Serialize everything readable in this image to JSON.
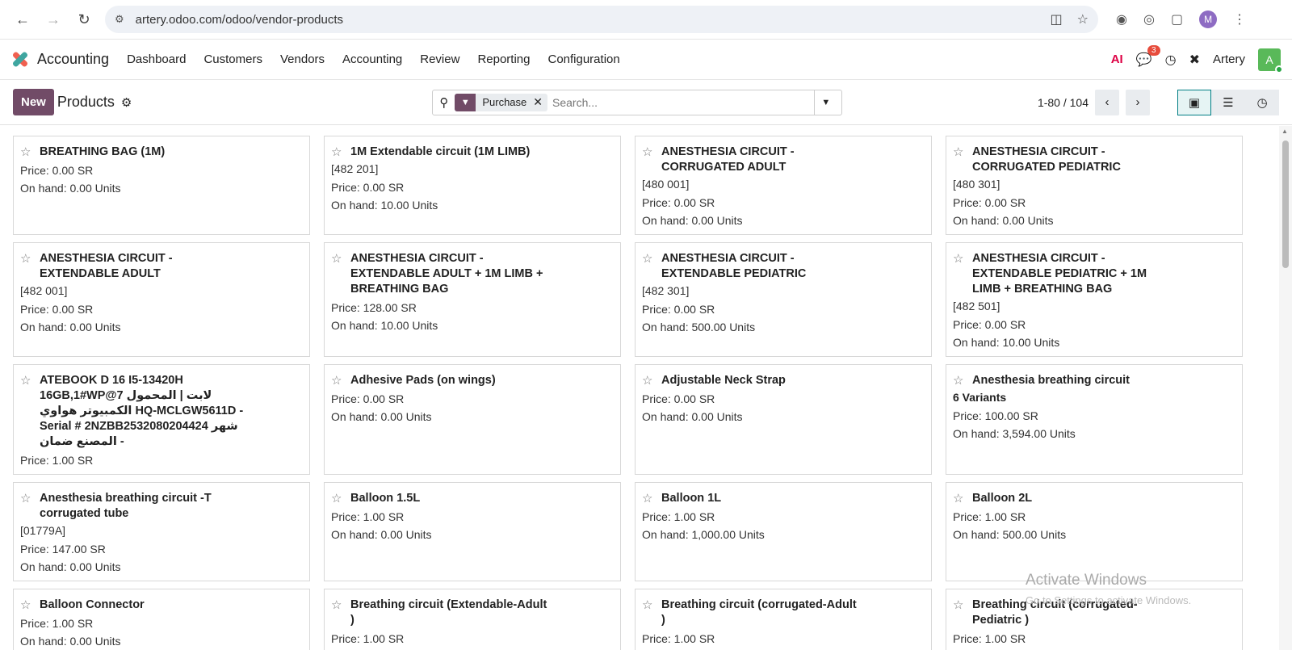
{
  "browser": {
    "url": "artery.odoo.com/odoo/vendor-products",
    "profile_initial": "M"
  },
  "navbar": {
    "app_name": "Accounting",
    "menu": [
      "Dashboard",
      "Customers",
      "Vendors",
      "Accounting",
      "Review",
      "Reporting",
      "Configuration"
    ],
    "chat_count": "3",
    "company": "Artery",
    "user_initial": "A"
  },
  "control": {
    "new_label": "New",
    "title": "Products",
    "facet": "Purchase",
    "search_placeholder": "Search...",
    "pager": "1-80 / 104"
  },
  "cards": [
    {
      "title": "BREATHING BAG (1M)",
      "ref": "",
      "variants": "",
      "price": "Price: 0.00 SR",
      "onhand": "On hand: 0.00 Units"
    },
    {
      "title": "1M Extendable circuit (1M LIMB)",
      "ref": "[482 201]",
      "variants": "",
      "price": "Price: 0.00 SR",
      "onhand": "On hand: 10.00 Units"
    },
    {
      "title": "ANESTHESIA CIRCUIT -\nCORRUGATED ADULT",
      "ref": "[480 001]",
      "variants": "",
      "price": "Price: 0.00 SR",
      "onhand": "On hand: 0.00 Units"
    },
    {
      "title": "ANESTHESIA CIRCUIT -\nCORRUGATED PEDIATRIC",
      "ref": "[480 301]",
      "variants": "",
      "price": "Price: 0.00 SR",
      "onhand": "On hand: 0.00 Units"
    },
    {
      "title": "ANESTHESIA CIRCUIT -\nEXTENDABLE ADULT",
      "ref": "[482 001]",
      "variants": "",
      "price": "Price: 0.00 SR",
      "onhand": "On hand: 0.00 Units"
    },
    {
      "title": "ANESTHESIA CIRCUIT -\nEXTENDABLE ADULT + 1M LIMB +\nBREATHING BAG",
      "ref": "",
      "variants": "",
      "price": "Price: 128.00 SR",
      "onhand": "On hand: 10.00 Units"
    },
    {
      "title": "ANESTHESIA CIRCUIT -\nEXTENDABLE PEDIATRIC",
      "ref": "[482 301]",
      "variants": "",
      "price": "Price: 0.00 SR",
      "onhand": "On hand: 500.00 Units"
    },
    {
      "title": "ANESTHESIA CIRCUIT -\nEXTENDABLE PEDIATRIC + 1M\nLIMB + BREATHING BAG",
      "ref": "[482 501]",
      "variants": "",
      "price": "Price: 0.00 SR",
      "onhand": "On hand: 10.00 Units"
    },
    {
      "title": "ATEBOOK D 16 I5-13420H\n16GB,1#WP@7 لابت | المحمول\nالكمبيوتر هواوي HQ-MCLGW5611D -\nSerial # 2NZBB2532080204424 شهر\nالمصنع ضمان -",
      "ref": "",
      "variants": "",
      "price": "Price: 1.00 SR",
      "onhand": ""
    },
    {
      "title": "Adhesive Pads (on wings)",
      "ref": "",
      "variants": "",
      "price": "Price: 0.00 SR",
      "onhand": "On hand: 0.00 Units"
    },
    {
      "title": "Adjustable Neck Strap",
      "ref": "",
      "variants": "",
      "price": "Price: 0.00 SR",
      "onhand": "On hand: 0.00 Units"
    },
    {
      "title": "Anesthesia breathing circuit",
      "ref": "",
      "variants": "6 Variants",
      "price": "Price: 100.00 SR",
      "onhand": "On hand: 3,594.00 Units"
    },
    {
      "title": "Anesthesia breathing circuit -T\ncorrugated tube",
      "ref": "[01779A]",
      "variants": "",
      "price": "Price: 147.00 SR",
      "onhand": "On hand: 0.00 Units"
    },
    {
      "title": "Balloon 1.5L",
      "ref": "",
      "variants": "",
      "price": "Price: 1.00 SR",
      "onhand": "On hand: 0.00 Units"
    },
    {
      "title": "Balloon 1L",
      "ref": "",
      "variants": "",
      "price": "Price: 1.00 SR",
      "onhand": "On hand: 1,000.00 Units"
    },
    {
      "title": "Balloon 2L",
      "ref": "",
      "variants": "",
      "price": "Price: 1.00 SR",
      "onhand": "On hand: 500.00 Units"
    },
    {
      "title": "Balloon Connector",
      "ref": "",
      "variants": "",
      "price": "Price: 1.00 SR",
      "onhand": "On hand: 0.00 Units"
    },
    {
      "title": "Breathing circuit (Extendable-Adult\n)",
      "ref": "",
      "variants": "",
      "price": "Price: 1.00 SR",
      "onhand": ""
    },
    {
      "title": "Breathing circuit (corrugated-Adult\n)",
      "ref": "",
      "variants": "",
      "price": "Price: 1.00 SR",
      "onhand": ""
    },
    {
      "title": "Breathing circuit (corrugated-\nPediatric )",
      "ref": "",
      "variants": "",
      "price": "Price: 1.00 SR",
      "onhand": ""
    }
  ],
  "watermark": {
    "line1": "Activate Windows",
    "line2": "Go to Settings to activate Windows."
  }
}
